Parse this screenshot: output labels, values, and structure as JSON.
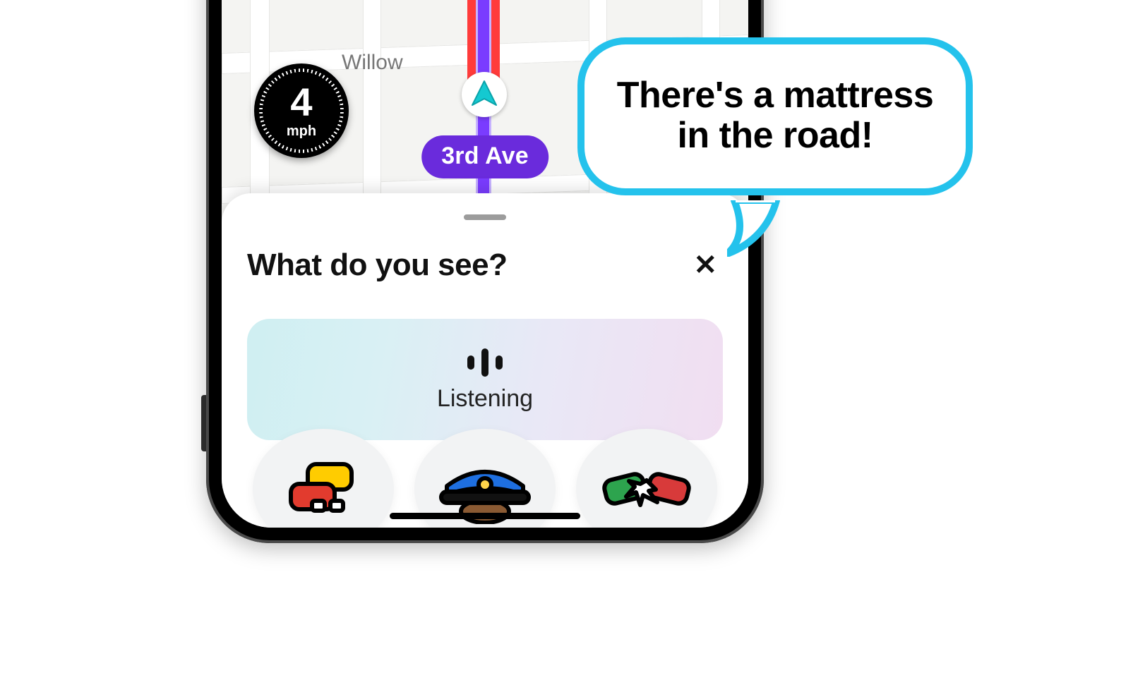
{
  "map": {
    "streets": {
      "willow": "Willow"
    },
    "current_street": "3rd Ave",
    "speed": {
      "value": "4",
      "unit": "mph"
    }
  },
  "sheet": {
    "title": "What do you see?",
    "listening_label": "Listening",
    "reports": [
      {
        "id": "traffic",
        "icon": "traffic-icon"
      },
      {
        "id": "police",
        "icon": "police-icon"
      },
      {
        "id": "crash",
        "icon": "crash-icon"
      }
    ]
  },
  "callout": {
    "line1": "There's a mattress",
    "line2": "in the road!"
  },
  "colors": {
    "accent_blue": "#24c2ec",
    "route_purple": "#7a3cff",
    "route_red": "#ff3b3b",
    "badge_purple": "#6a2bdc"
  }
}
